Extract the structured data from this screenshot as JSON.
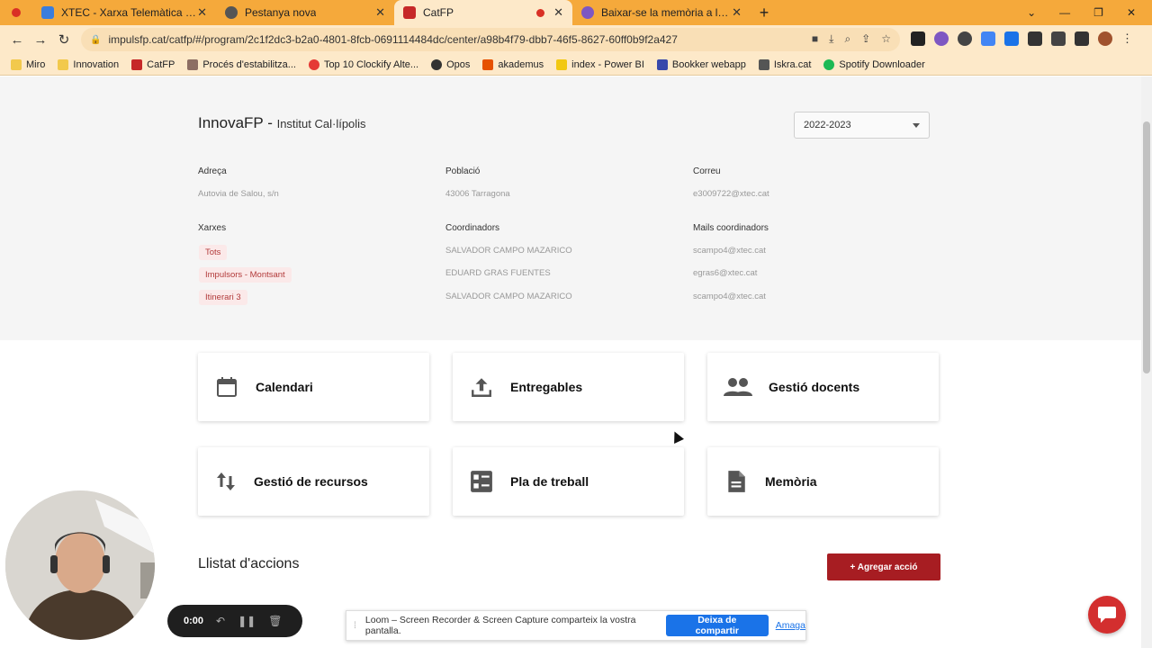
{
  "browser": {
    "tabs": [
      {
        "label": "XTEC - Xarxa Telemàtica Educativa",
        "favicon_color": "#3b7ddd"
      },
      {
        "label": "Pestanya nova",
        "favicon_color": "#555555"
      },
      {
        "label": "CatFP",
        "favicon_color": "#c62828"
      },
      {
        "label": "Baixar-se la memòria a la plataforma",
        "favicon_color": "#7e57c2"
      }
    ],
    "url": "impulsfp.cat/catfp/#/program/2c1f2dc3-b2a0-4801-8fcb-0691114484dc/center/a98b4f79-dbb7-46f5-8627-60ff0b9f2a427",
    "bookmarks": [
      "Miro",
      "Innovation",
      "CatFP",
      "Procés d'estabilitza...",
      "Top 10 Clockify Alte...",
      "Opos",
      "akademus",
      "index - Power BI",
      "Bookker webapp",
      "Iskra.cat",
      "Spotify Downloader"
    ]
  },
  "header": {
    "app_name": "InnovaFP",
    "separator": " - ",
    "school": "Institut Cal·lípolis",
    "year_selected": "2022-2023"
  },
  "info": {
    "address_label": "Adreça",
    "address": "Autovia de Salou, s/n",
    "town_label": "Població",
    "town": "43006 Tarragona",
    "email_label": "Correu",
    "email": "e3009722@xtec.cat",
    "networks_label": "Xarxes",
    "networks": [
      "Tots",
      "Impulsors - Montsant",
      "Itinerari 3"
    ],
    "coordinators_label": "Coordinadors",
    "coordinators": [
      "SALVADOR CAMPO MAZARICO",
      "EDUARD GRAS FUENTES",
      "SALVADOR CAMPO MAZARICO"
    ],
    "coordinator_mails_label": "Mails coordinadors",
    "coordinator_mails": [
      "scampo4@xtec.cat",
      "egras6@xtec.cat",
      "scampo4@xtec.cat"
    ]
  },
  "cards": [
    {
      "label": "Calendari",
      "icon": "calendar-icon"
    },
    {
      "label": "Entregables",
      "icon": "upload-icon"
    },
    {
      "label": "Gestió docents",
      "icon": "people-icon"
    },
    {
      "label": "Gestió de recursos",
      "icon": "swap-vertical-icon"
    },
    {
      "label": "Pla de treball",
      "icon": "checklist-icon"
    },
    {
      "label": "Memòria",
      "icon": "document-icon"
    }
  ],
  "actions": {
    "title": "Llistat d'accions",
    "add_label": "+ Agregar acció"
  },
  "recorder": {
    "time": "0:00"
  },
  "share": {
    "message": "Loom – Screen Recorder & Screen Capture comparteix la vostra pantalla.",
    "stop_label": "Deixa de compartir",
    "hide_label": "Amaga"
  },
  "colors": {
    "accent": "#a71d22",
    "chip_text": "#b23a3a",
    "browser_frame": "#f5a93b"
  }
}
